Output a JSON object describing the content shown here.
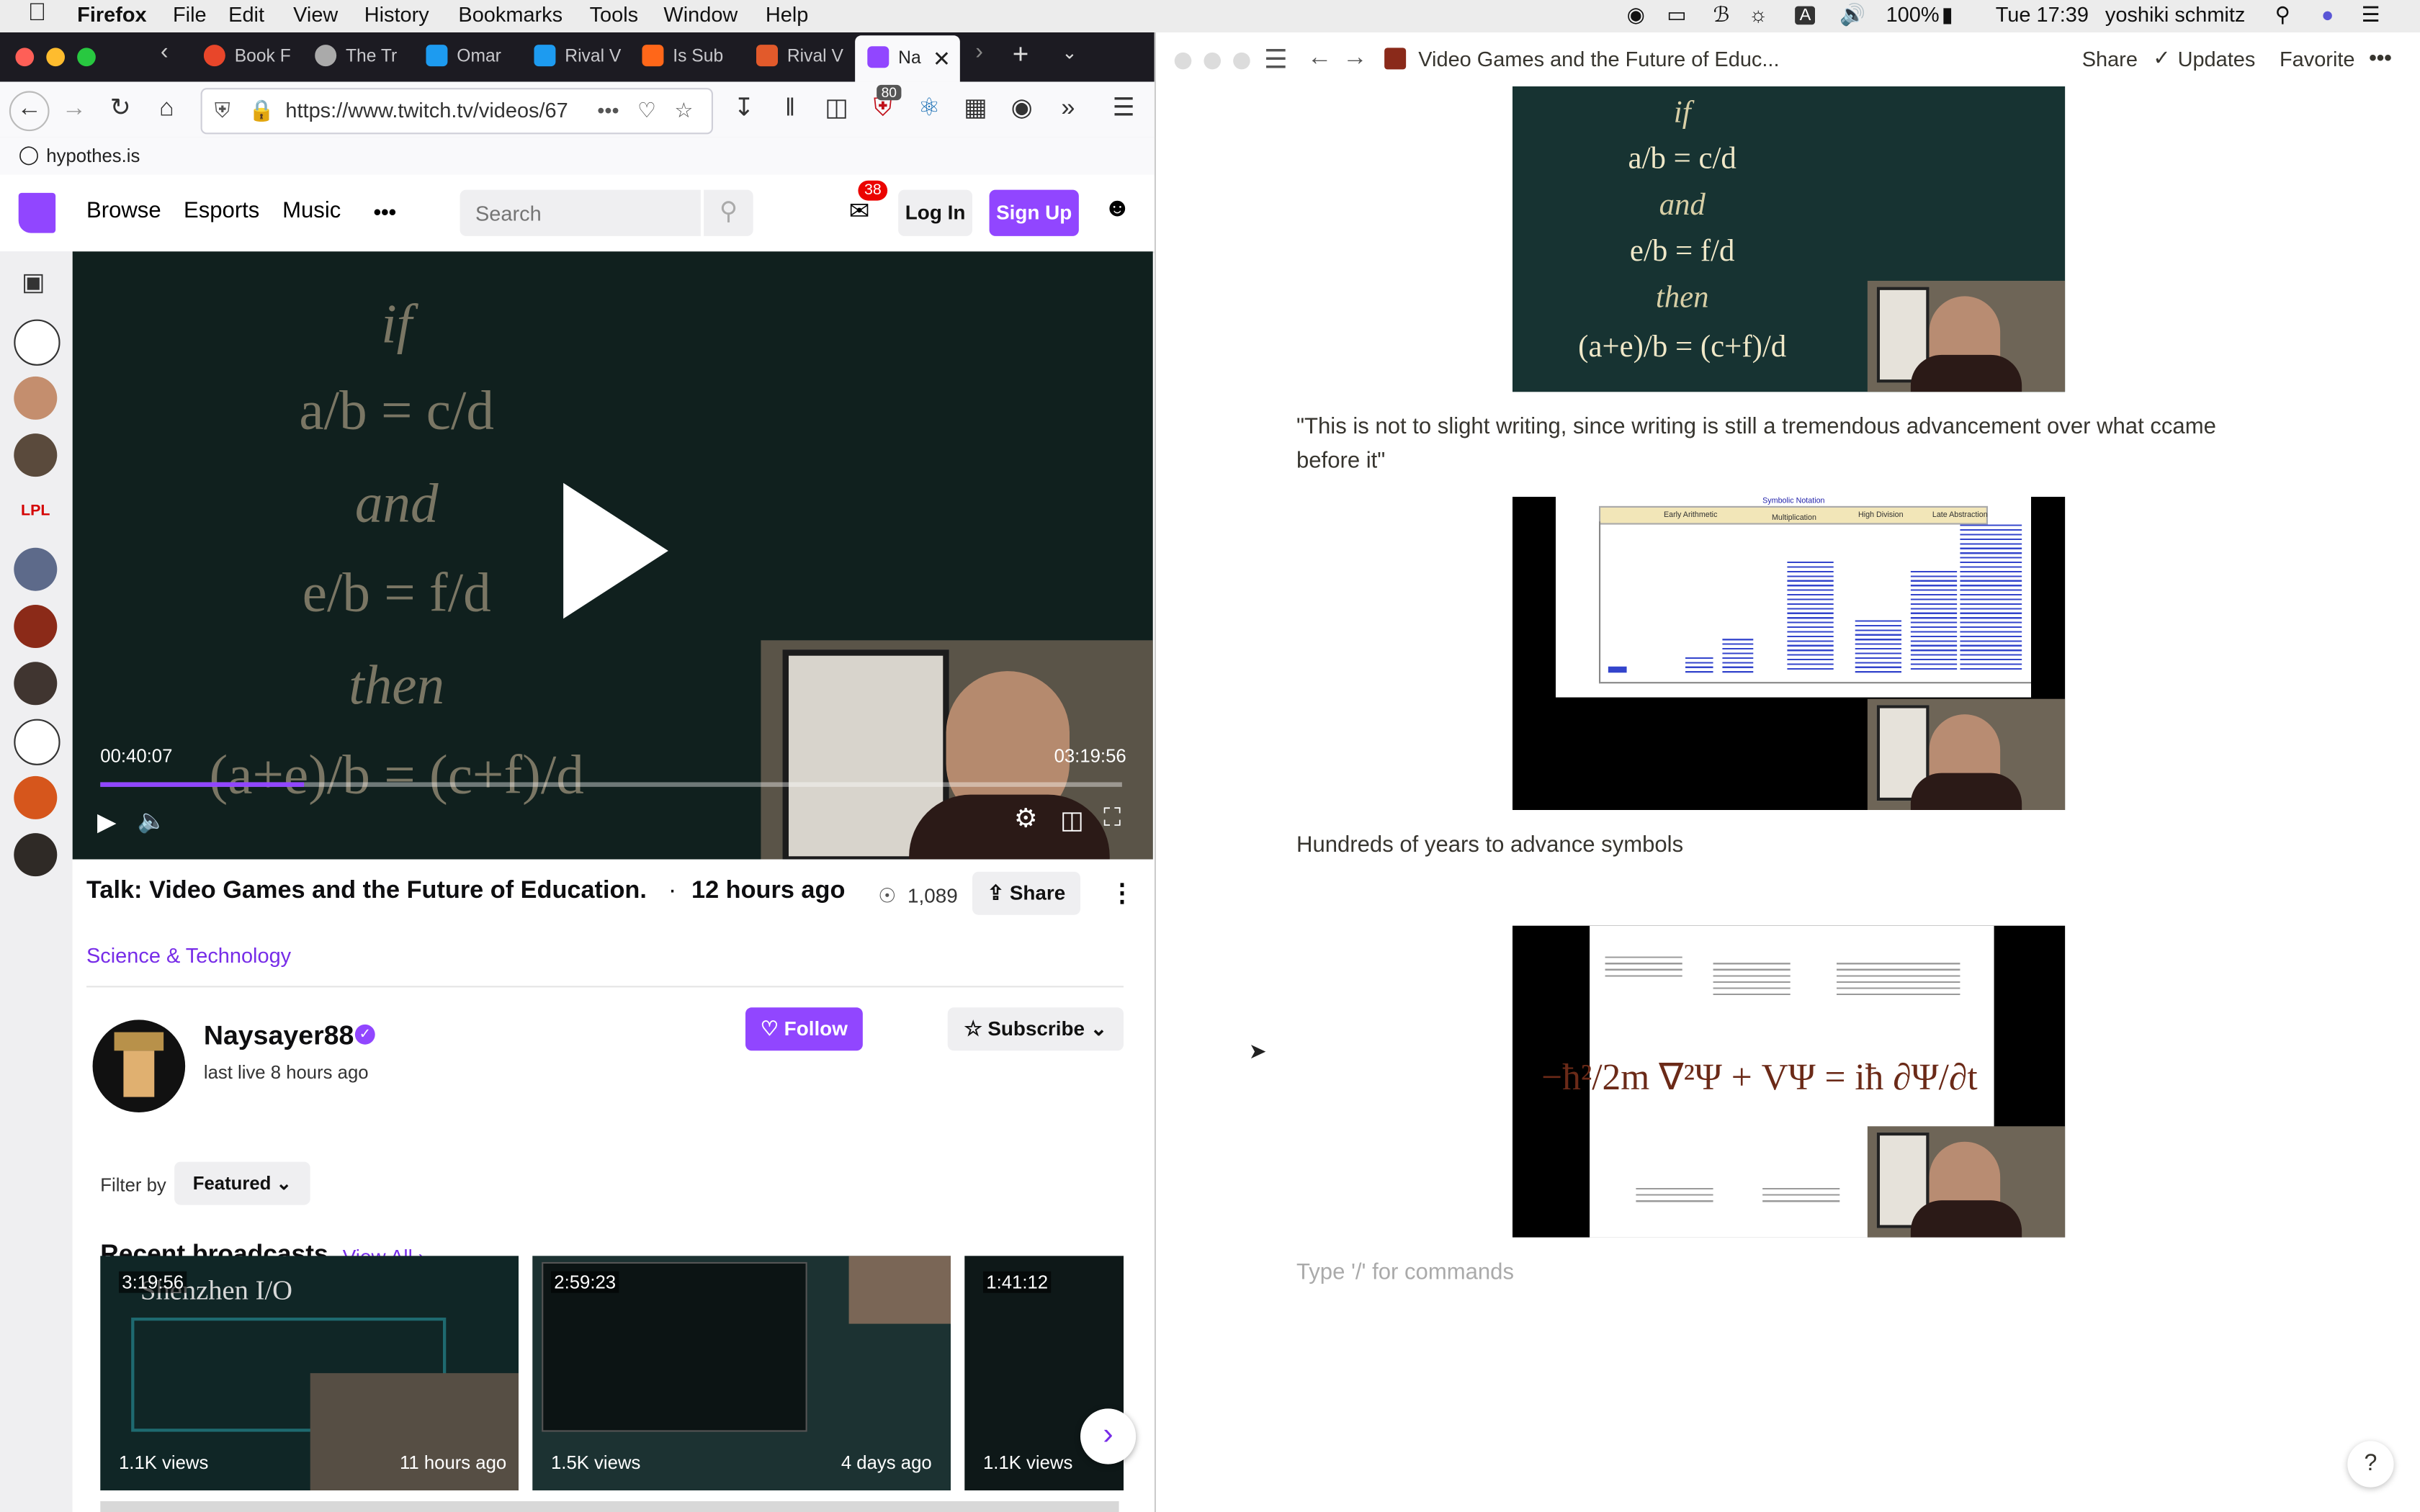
{
  "menubar": {
    "apple_icon": "apple-icon",
    "app_name": "Firefox",
    "menus": [
      "File",
      "Edit",
      "View",
      "History",
      "Bookmarks",
      "Tools",
      "Window",
      "Help"
    ],
    "battery": "100%",
    "clock": "Tue 17:39",
    "user": "yoshiki schmitz"
  },
  "firefox": {
    "tabs": [
      {
        "label": "Book F",
        "color": "#e8462a"
      },
      {
        "label": "The Tr",
        "color": "#cccccc"
      },
      {
        "label": "Omar",
        "color": "#1d9bf0"
      },
      {
        "label": "Rival V",
        "color": "#1d9bf0"
      },
      {
        "label": "Is Sub",
        "color": "#ff6719"
      },
      {
        "label": "Rival V",
        "color": "#e25a2b"
      },
      {
        "label": "Na",
        "color": "#9146ff"
      }
    ],
    "url": "https://www.twitch.tv/videos/67",
    "ublock_count": "80",
    "bookmark": "hypothes.is"
  },
  "twitch": {
    "nav": {
      "browse": "Browse",
      "esports": "Esports",
      "music": "Music",
      "more": "•••"
    },
    "search_placeholder": "Search",
    "inbox_count": "38",
    "login": "Log In",
    "signup": "Sign Up",
    "player": {
      "math": [
        "if",
        "a/b = c/d",
        "and",
        "e/b = f/d",
        "then",
        "(a+e)/b = (c+f)/d"
      ],
      "current_time": "00:40:07",
      "duration": "03:19:56",
      "progress": 0.2
    },
    "video": {
      "title": "Talk: Video Games and the Future of Education.",
      "dot": "·",
      "age": "12 hours ago",
      "views": "1,089",
      "share": "Share",
      "category": "Science & Technology"
    },
    "channel": {
      "name": "Naysayer88",
      "last_live": "last live 8 hours ago",
      "follow": "Follow",
      "subscribe": "Subscribe"
    },
    "filter": {
      "label": "Filter by",
      "value": "Featured"
    },
    "recent": {
      "heading": "Recent broadcasts",
      "view_all": "View All",
      "items": [
        {
          "duration": "3:19:56",
          "views": "1.1K views",
          "age": "11 hours ago",
          "overlay_title": "Shenzhen I/O"
        },
        {
          "duration": "2:59:23",
          "views": "1.5K views",
          "age": "4 days ago"
        },
        {
          "duration": "1:41:12",
          "views": "1.1K views",
          "age": ""
        }
      ]
    }
  },
  "notion": {
    "page_title": "Video Games and the Future of Educ...",
    "share": "Share",
    "updates": "Updates",
    "favorite": "Favorite",
    "more": "•••",
    "slide1_math": [
      "if",
      "a/b = c/d",
      "and",
      "e/b = f/d",
      "then",
      "(a+e)/b = (c+f)/d"
    ],
    "quote": "\"This is not to slight writing, since writing is still a tremendous advancement over what ccame before it\"",
    "chart_labels": [
      "Symbolic Notation",
      "Early Arithmetic",
      "Multiplication",
      "High Division",
      "Late Abstraction"
    ],
    "chart_caption": "Hundreds of years to advance symbols",
    "equation": "−ħ²/2m ∇²Ψ + VΨ = iħ ∂Ψ/∂t",
    "placeholder": "Type '/' for commands",
    "help": "?"
  }
}
